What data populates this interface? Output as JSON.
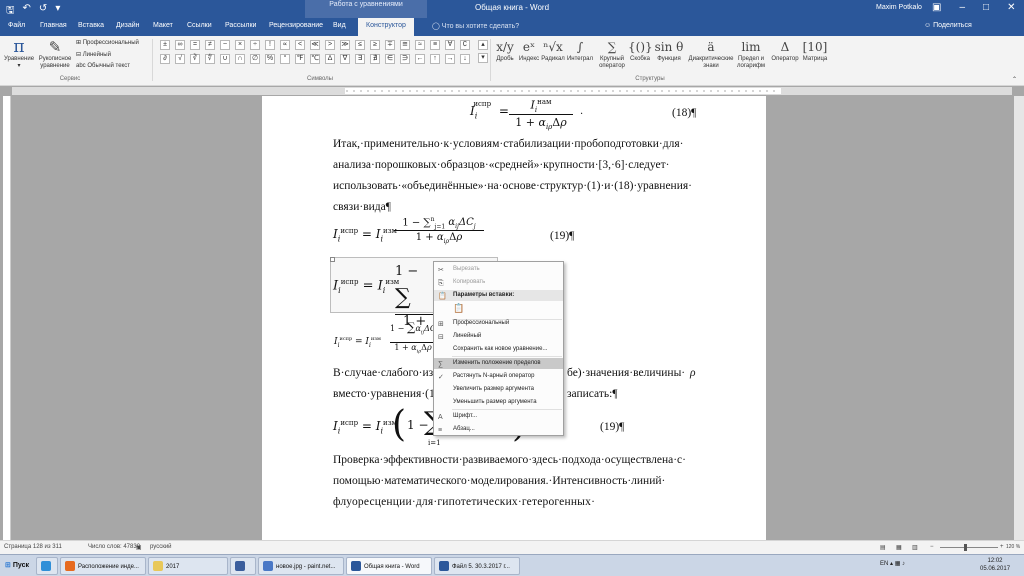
{
  "titlebar": {
    "context_tab": "Работа с уравнениями",
    "title": "Общая книга  -  Word",
    "user": "Maxim Potkalo"
  },
  "tabs": {
    "items": [
      "Файл",
      "Главная",
      "Вставка",
      "Дизайн",
      "Макет",
      "Ссылки",
      "Рассылки",
      "Рецензирование",
      "Вид"
    ],
    "active": "Конструктор",
    "tell": "Что вы хотите сделать?",
    "share": "Поделиться"
  },
  "ribbon": {
    "equation": {
      "label_l1": "Уравнение"
    },
    "ink": {
      "label_l1": "Рукописное",
      "label_l2": "уравнение"
    },
    "mode_options": [
      "Профессиональный",
      "Линейный",
      "abc Обычный текст"
    ],
    "group_service": "Сервис",
    "group_symbols": "Символы",
    "group_structures": "Структуры",
    "symbols_row1": [
      "±",
      "∞",
      "=",
      "≠",
      "~",
      "×",
      "÷",
      "!",
      "∝",
      "<",
      "≪",
      ">",
      "≫",
      "≤",
      "≥",
      "∓",
      "≅",
      "≈",
      "≡",
      "∀",
      "∁"
    ],
    "symbols_row2": [
      "∂",
      "√",
      "∛",
      "∜",
      "∪",
      "∩",
      "∅",
      "%",
      "°",
      "℉",
      "℃",
      "∆",
      "∇",
      "∃",
      "∄",
      "∈",
      "∋",
      "←",
      "↑",
      "→",
      "↓"
    ],
    "structures": [
      {
        "glyph": "x/y",
        "label_l1": "Дробь"
      },
      {
        "glyph": "eˣ",
        "label_l1": "Индекс"
      },
      {
        "glyph": "ⁿ√x",
        "label_l1": "Радикал"
      },
      {
        "glyph": "∫",
        "label_l1": "Интеграл"
      },
      {
        "glyph": "∑",
        "label_l1": "Крупный",
        "label_l2": "оператор"
      },
      {
        "glyph": "{()}",
        "label_l1": "Скобка"
      },
      {
        "glyph": "sin θ",
        "label_l1": "Функция"
      },
      {
        "glyph": "ä",
        "label_l1": "Диакритические",
        "label_l2": "знаки"
      },
      {
        "glyph": "lim",
        "label_l1": "Предел и",
        "label_l2": "логарифм"
      },
      {
        "glyph": "Δ",
        "label_l1": "Оператор"
      },
      {
        "glyph": "[10]",
        "label_l1": "Матрица"
      }
    ]
  },
  "document": {
    "para1": [
      "Итак,·применительно·к·условиям·стабилизации·пробоподготовки·для·",
      "анализа·порошковых·образцов·«средней»·крупности·[3,·6]·следует·",
      "использовать·«объединённые»·на·основе·структур·(1)·и·(18)·уравнения·",
      "связи·вида¶"
    ],
    "para2_l1a": "В·случае·слабого·из",
    "para2_l1b": "бе)·значения·величины·",
    "para2_l1c": "ρ",
    "para2_l2a": "вместо·уравнения·(1",
    "para2_l2b": "записать:¶",
    "para3": [
      "Проверка·эффективности·развиваемого·здесь·подхода·осуществлена·с·",
      "помощью·математического·моделирования.·Интенсивность·линий·",
      "флуоресценции·для·гипотетических·гетерогенных·"
    ],
    "eq18_num": "(18)¶",
    "eq19_num": "(19)¶",
    "eq19b_num": "(19)¶",
    "sup_ispr": "испр",
    "sup_izm": "изм",
    "sup_nam": "нам"
  },
  "context_menu": {
    "cut": "Вырезать",
    "copy": "Копировать",
    "paste_header": "Параметры вставки:",
    "professional": "Профессиональный",
    "linear": "Линейный",
    "save_as_new": "Сохранить как новое уравнение...",
    "change_limits": "Изменить положение пределов",
    "stretch_operator": "Растянуть N-арный оператор",
    "increase_arg": "Увеличить размер аргумента",
    "decrease_arg": "Уменьшить размер аргумента",
    "font": "Шрифт...",
    "paragraph": "Абзац..."
  },
  "statusbar": {
    "page": "Страница 128 из 311",
    "words": "Число слов: 47830",
    "language": "русский",
    "zoom": "120 %"
  },
  "taskbar": {
    "start": "Пуск",
    "items": [
      {
        "label": "Расположение инде...",
        "color": "#e66a1f"
      },
      {
        "label": "2017",
        "color": "#e8c85a"
      },
      {
        "label": "",
        "color": "#3a5d9c"
      },
      {
        "label": "новое.jpg - paint.net...",
        "color": "#4a78c6"
      },
      {
        "label": "Общая книга - Word",
        "color": "#2b579a"
      },
      {
        "label": "Файл 5. 30.3.2017 г...",
        "color": "#2b579a"
      }
    ],
    "lang": "EN",
    "time": "12:02",
    "date": "05.06.2017"
  }
}
